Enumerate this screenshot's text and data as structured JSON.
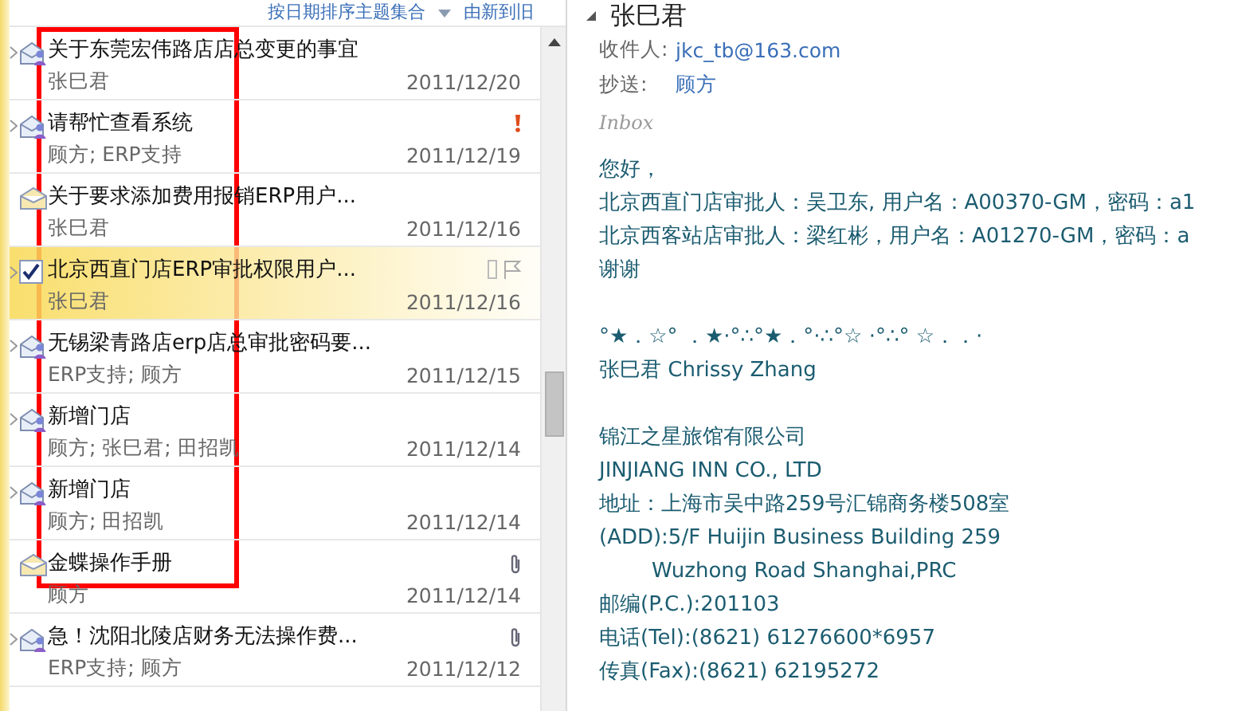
{
  "list_header": {
    "sort": "按日期排序主题集合",
    "order": "由新到旧"
  },
  "messages": [
    {
      "subject": "关于东莞宏伟路店店总变更的事宜",
      "from": "张巳君",
      "date": "2011/12/20",
      "thread": true,
      "kind": "group",
      "important": false,
      "attachment": false,
      "flagged": false,
      "selected": false
    },
    {
      "subject": "请帮忙查看系统",
      "from": "顾方; ERP支持",
      "date": "2011/12/19",
      "thread": true,
      "kind": "group",
      "important": true,
      "attachment": false,
      "flagged": false,
      "selected": false
    },
    {
      "subject": "关于要求添加费用报销ERP用户...",
      "from": "张巳君",
      "date": "2011/12/16",
      "thread": false,
      "kind": "single",
      "important": false,
      "attachment": false,
      "flagged": false,
      "selected": false
    },
    {
      "subject": "北京西直门店ERP审批权限用户...",
      "from": "张巳君",
      "date": "2011/12/16",
      "thread": true,
      "kind": "checked",
      "important": false,
      "attachment": false,
      "flagged": true,
      "selected": true
    },
    {
      "subject": "无锡梁青路店erp店总审批密码要...",
      "from": "ERP支持; 顾方",
      "date": "2011/12/15",
      "thread": true,
      "kind": "group",
      "important": false,
      "attachment": false,
      "flagged": false,
      "selected": false
    },
    {
      "subject": "新增门店",
      "from": "顾方; 张巳君; 田招凯",
      "date": "2011/12/14",
      "thread": true,
      "kind": "group",
      "important": false,
      "attachment": false,
      "flagged": false,
      "selected": false
    },
    {
      "subject": "新增门店",
      "from": "顾方; 田招凯",
      "date": "2011/12/14",
      "thread": true,
      "kind": "group",
      "important": false,
      "attachment": false,
      "flagged": false,
      "selected": false
    },
    {
      "subject": "金蝶操作手册",
      "from": "顾方",
      "date": "2011/12/14",
      "thread": false,
      "kind": "single",
      "important": false,
      "attachment": true,
      "flagged": false,
      "selected": false
    },
    {
      "subject": "急！沈阳北陵店财务无法操作费...",
      "from": "ERP支持; 顾方",
      "date": "2011/12/12",
      "thread": true,
      "kind": "group",
      "important": false,
      "attachment": true,
      "flagged": false,
      "selected": false
    }
  ],
  "reading": {
    "sender": "张巳君",
    "to_label": "收件人:",
    "to": "jkc_tb@163.com",
    "cc_label": "抄送:",
    "cc": "顾方",
    "folder": "Inbox",
    "body": [
      {
        "kind": "text",
        "text": "您好，"
      },
      {
        "kind": "text",
        "text": "北京西直门店审批人：吴卫东, 用户名：A00370-GM，密码：a1"
      },
      {
        "kind": "text",
        "text": "北京西客站店审批人：梁红彬，用户名：A01270-GM，密码：a"
      },
      {
        "kind": "text",
        "text": "谢谢"
      },
      {
        "kind": "blank"
      },
      {
        "kind": "text",
        "text": "°★．☆° ．★·°∴°★．°·∴°☆ ·°∴° ☆．．·"
      },
      {
        "kind": "text",
        "text": "张巳君    Chrissy Zhang"
      },
      {
        "kind": "blank"
      },
      {
        "kind": "text",
        "text": "锦江之星旅馆有限公司"
      },
      {
        "kind": "text",
        "text": "JINJIANG INN CO., LTD"
      },
      {
        "kind": "text",
        "text": "地址：上海市吴中路259号汇锦商务楼508室"
      },
      {
        "kind": "text",
        "text": "(ADD):5/F Huijin Business Building 259"
      },
      {
        "kind": "indent",
        "text": "Wuzhong Road Shanghai,PRC"
      },
      {
        "kind": "text",
        "text": "邮编(P.C.):201103"
      },
      {
        "kind": "text",
        "text": "电话(Tel):(8621) 61276600*6957"
      },
      {
        "kind": "text",
        "text": "传真(Fax):(8621) 62195272"
      }
    ]
  }
}
